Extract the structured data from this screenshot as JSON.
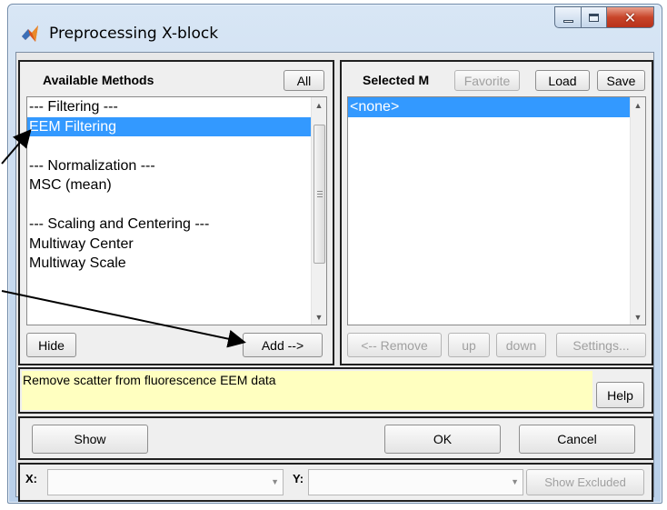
{
  "window": {
    "title": "Preprocessing X-block",
    "minimize_icon": "minimize-icon",
    "maximize_icon": "maximize-icon",
    "close_icon": "close-icon"
  },
  "available": {
    "header": "Available Methods",
    "all_label": "All",
    "items": [
      {
        "label": "--- Filtering ---",
        "selected": false
      },
      {
        "label": "EEM Filtering",
        "selected": true
      },
      {
        "label": "",
        "selected": false
      },
      {
        "label": "--- Normalization ---",
        "selected": false
      },
      {
        "label": "MSC (mean)",
        "selected": false
      },
      {
        "label": "",
        "selected": false
      },
      {
        "label": "--- Scaling and Centering ---",
        "selected": false
      },
      {
        "label": "Multiway Center",
        "selected": false
      },
      {
        "label": "Multiway Scale",
        "selected": false
      }
    ],
    "hide_label": "Hide",
    "add_label": "Add -->"
  },
  "selected": {
    "header": "Selected M",
    "favorite_label": "Favorite",
    "load_label": "Load",
    "save_label": "Save",
    "items": [
      {
        "label": "<none>",
        "selected": true
      }
    ],
    "remove_label": "<-- Remove",
    "up_label": "up",
    "down_label": "down",
    "settings_label": "Settings..."
  },
  "description": {
    "text": "Remove scatter from fluorescence EEM data",
    "help_label": "Help"
  },
  "actions": {
    "show_label": "Show",
    "ok_label": "OK",
    "cancel_label": "Cancel"
  },
  "axes": {
    "x_label": "X:",
    "x_value": "",
    "y_label": "Y:",
    "y_value": "",
    "show_excluded_label": "Show Excluded"
  },
  "colors": {
    "selection": "#3399ff",
    "description_bg": "#ffffc0",
    "panel_border": "#202020"
  }
}
